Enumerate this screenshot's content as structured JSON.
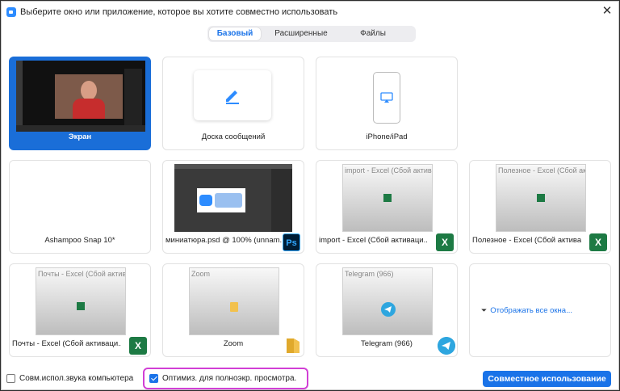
{
  "window": {
    "title": "Выберите окно или приложение, которое вы хотите совместно использовать",
    "close_glyph": "✕"
  },
  "tabs": [
    {
      "label": "Базовый",
      "active": true
    },
    {
      "label": "Расширенные",
      "active": false
    },
    {
      "label": "Файлы",
      "active": false
    }
  ],
  "tiles": {
    "screen": {
      "label": "Экран"
    },
    "whiteboard": {
      "label": "Доска сообщений",
      "icon": "pencil-icon"
    },
    "iphone": {
      "label": "iPhone/iPad",
      "icon": "airplay-icon"
    },
    "ashampoo": {
      "label": "Ashampoo Snap 10*"
    },
    "psd": {
      "label": "миниатюра.psd @ 100% (unnam...",
      "badge": "Ps"
    },
    "import_excel": {
      "label": "import - Excel (Сбой активаци...",
      "caption": "import - Excel (Сбой активац",
      "badge": "X"
    },
    "useful_excel": {
      "label": "Полезное - Excel (Сбой активаци...",
      "caption": "Полезное - Excel (Сбой актив",
      "badge": "X"
    },
    "mail_excel": {
      "label": "Почты - Excel (Сбой активаци...",
      "caption": "Почты - Excel (Сбой активаци",
      "badge": "X"
    },
    "zoom": {
      "label": "Zoom",
      "caption": "Zoom"
    },
    "telegram": {
      "label": "Telegram (966)",
      "caption": "Telegram (966)"
    },
    "show_all": {
      "label": "Отображать все окна..."
    }
  },
  "footer": {
    "share_audio": {
      "label": "Совм.испол.звука компьютера",
      "checked": false
    },
    "optimize": {
      "label": "Оптимиз. для полноэкр. просмотра.",
      "checked": true
    },
    "share_button": "Совместное использование"
  },
  "colors": {
    "accent": "#1a73e8",
    "selected_tile": "#1a6ed8",
    "highlight": "#d13fd5"
  }
}
